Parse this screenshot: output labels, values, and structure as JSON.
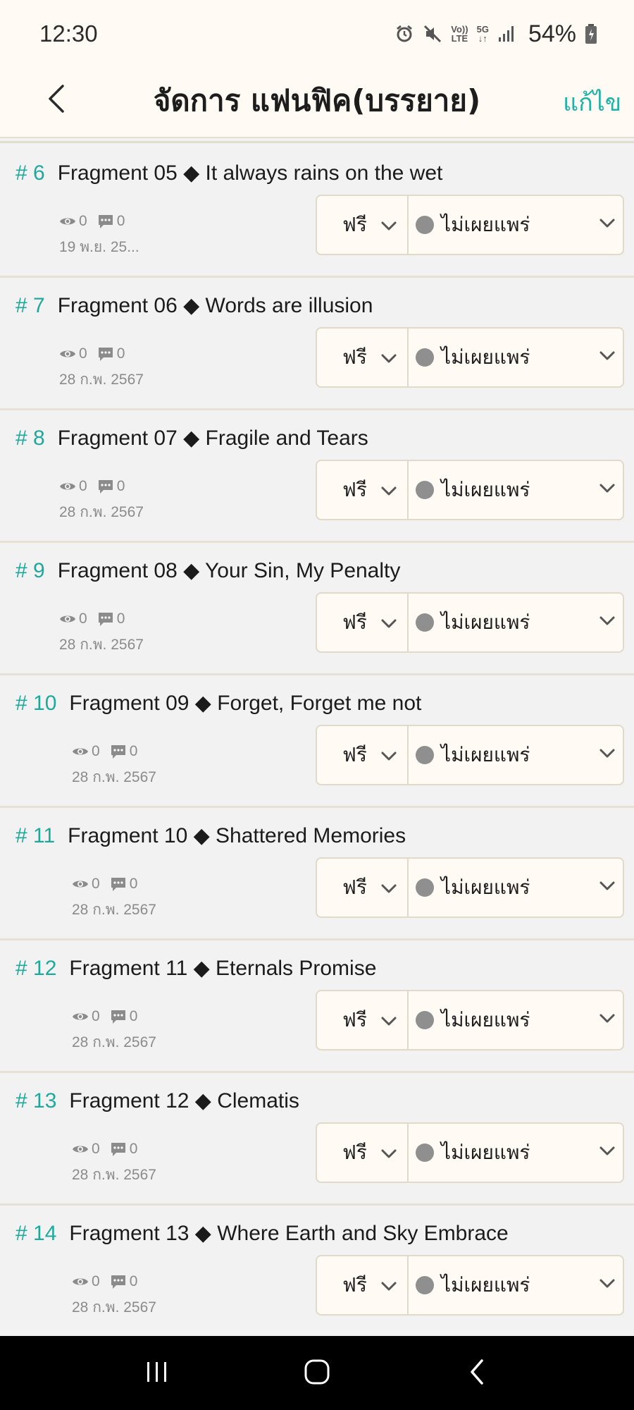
{
  "status_bar": {
    "time": "12:30",
    "network_top": "Vo))",
    "network_bottom": "LTE",
    "gen": "5G",
    "battery": "54%"
  },
  "header": {
    "title": "จัดการ แฟนฟิค(บรรยาย)",
    "edit_label": "แก้ไข"
  },
  "colors": {
    "accent": "#20b2a6",
    "background": "#f1f2f1",
    "surface": "#fffaf3",
    "unpublished_dot": "#8f8f8f"
  },
  "chapters": [
    {
      "num": "# 6",
      "title": "Fragment 05 ◆ It always rains on the wet",
      "views": "0",
      "comments": "0",
      "date": "19 พ.ย. 25...",
      "price": "ฟรี",
      "status": "ไม่เผยแพร่"
    },
    {
      "num": "# 7",
      "title": "Fragment 06 ◆ Words are illusion",
      "views": "0",
      "comments": "0",
      "date": "28 ก.พ. 2567",
      "price": "ฟรี",
      "status": "ไม่เผยแพร่"
    },
    {
      "num": "# 8",
      "title": "Fragment 07 ◆ Fragile and Tears",
      "views": "0",
      "comments": "0",
      "date": "28 ก.พ. 2567",
      "price": "ฟรี",
      "status": "ไม่เผยแพร่"
    },
    {
      "num": "# 9",
      "title": "Fragment 08 ◆ Your Sin, My Penalty",
      "views": "0",
      "comments": "0",
      "date": "28 ก.พ. 2567",
      "price": "ฟรี",
      "status": "ไม่เผยแพร่"
    },
    {
      "num": "# 10",
      "title": "Fragment 09 ◆ Forget, Forget me not",
      "views": "0",
      "comments": "0",
      "date": "28 ก.พ. 2567",
      "price": "ฟรี",
      "status": "ไม่เผยแพร่"
    },
    {
      "num": "# 11",
      "title": "Fragment 10 ◆ Shattered Memories",
      "views": "0",
      "comments": "0",
      "date": "28 ก.พ. 2567",
      "price": "ฟรี",
      "status": "ไม่เผยแพร่"
    },
    {
      "num": "# 12",
      "title": "Fragment 11 ◆ Eternals Promise",
      "views": "0",
      "comments": "0",
      "date": "28 ก.พ. 2567",
      "price": "ฟรี",
      "status": "ไม่เผยแพร่"
    },
    {
      "num": "# 13",
      "title": "Fragment 12 ◆ Clematis",
      "views": "0",
      "comments": "0",
      "date": "28 ก.พ. 2567",
      "price": "ฟรี",
      "status": "ไม่เผยแพร่"
    },
    {
      "num": "# 14",
      "title": "Fragment 13 ◆ Where Earth and Sky Embrace",
      "views": "0",
      "comments": "0",
      "date": "28 ก.พ. 2567",
      "price": "ฟรี",
      "status": "ไม่เผยแพร่"
    }
  ],
  "nav": {
    "recents_icon": "recents-icon",
    "home_icon": "home-icon",
    "back_icon": "back-icon"
  }
}
